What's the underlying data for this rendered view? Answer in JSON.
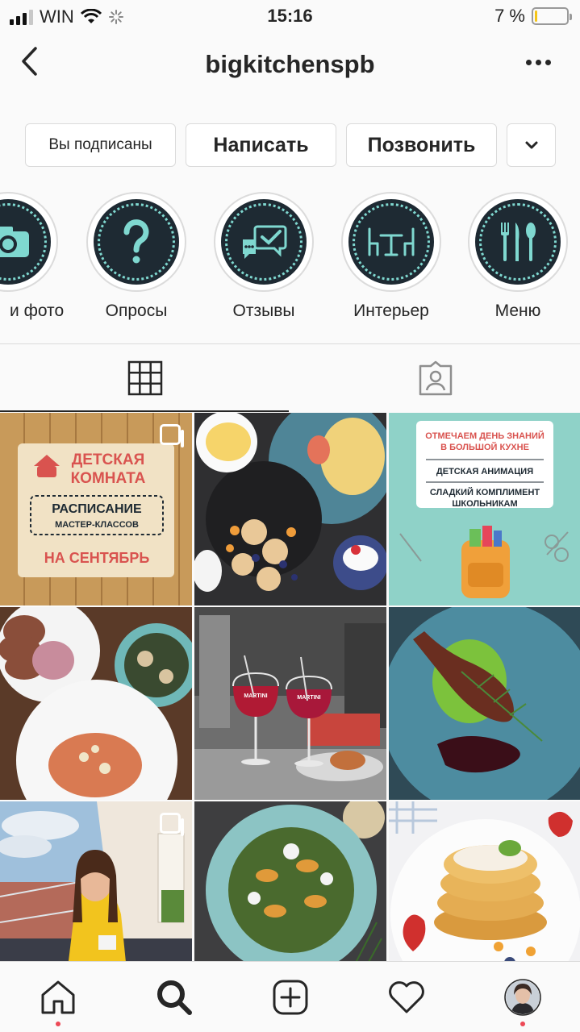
{
  "status_bar": {
    "carrier": "WIN",
    "time": "15:16",
    "battery_text": "7 %",
    "battery_level": 0.07
  },
  "header": {
    "title": "bigkitchenspb"
  },
  "actions": {
    "subscribed": "Вы подписаны",
    "message": "Написать",
    "call": "Позвонить"
  },
  "highlights": [
    {
      "label": "и фото",
      "icon": "camera-icon"
    },
    {
      "label": "Опросы",
      "icon": "question-icon"
    },
    {
      "label": "Отзывы",
      "icon": "chat-check-icon"
    },
    {
      "label": "Интерьер",
      "icon": "table-chairs-icon"
    },
    {
      "label": "Меню",
      "icon": "cutlery-icon"
    }
  ],
  "tabs": [
    {
      "name": "grid",
      "icon": "grid-icon",
      "active": true
    },
    {
      "name": "tagged",
      "icon": "tagged-person-icon",
      "active": false
    }
  ],
  "posts": {
    "p1": {
      "line1": "ДЕТСКАЯ",
      "line2": "КОМНАТА",
      "box1": "РАСПИСАНИЕ",
      "box2": "МАСТЕР-КЛАССОВ",
      "line3": "НА СЕНТЯБРЬ"
    },
    "p3": {
      "title1": "ОТМЕЧАЕМ ДЕНЬ ЗНАНИЙ",
      "title2": "В БОЛЬШОЙ КУХНЕ",
      "item1": "ДЕТСКАЯ АНИМАЦИЯ",
      "item2": "СЛАДКИЙ КОМПЛИМЕНТ",
      "item3": "ШКОЛЬНИКАМ"
    },
    "p5": {
      "brand": "MARTINI"
    }
  },
  "bottom_nav": [
    "home-icon",
    "search-icon",
    "add-post-icon",
    "heart-icon",
    "profile-avatar"
  ],
  "colors": {
    "accent_dot": "#ed4956",
    "highlight_bg": "#1e2a33",
    "highlight_icon": "#7fd8d0"
  }
}
